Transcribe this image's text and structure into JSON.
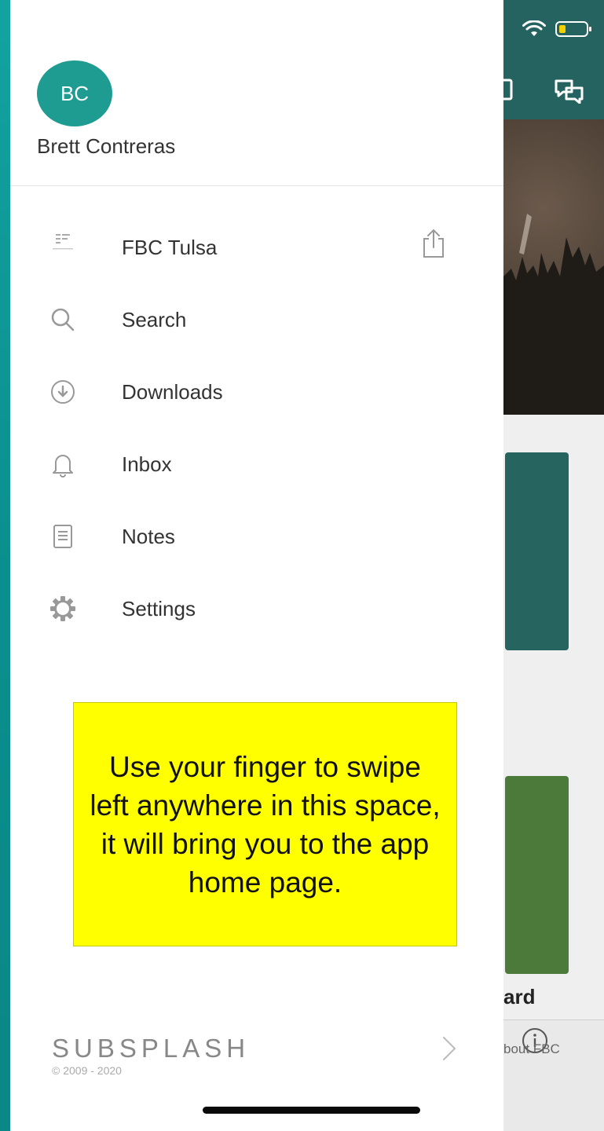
{
  "user": {
    "initials": "BC",
    "name": "Brett Contreras"
  },
  "menu": [
    {
      "label": "FBC Tulsa",
      "icon": "fellowship-logo-icon"
    },
    {
      "label": "Search",
      "icon": "search-icon"
    },
    {
      "label": "Downloads",
      "icon": "download-icon"
    },
    {
      "label": "Inbox",
      "icon": "bell-icon"
    },
    {
      "label": "Notes",
      "icon": "notes-icon"
    },
    {
      "label": "Settings",
      "icon": "gear-icon"
    }
  ],
  "callout": {
    "text": "Use your finger to swipe left anywhere in this space, it will bring you to the app home page."
  },
  "footer": {
    "brand": "SUBSPLASH",
    "copyright": "© 2009 - 2020"
  },
  "background_app": {
    "card_label": "ard",
    "tab_label": "bout FBC"
  },
  "colors": {
    "accent": "#1e9c91",
    "header": "#24635f",
    "callout_bg": "#ffff00"
  }
}
